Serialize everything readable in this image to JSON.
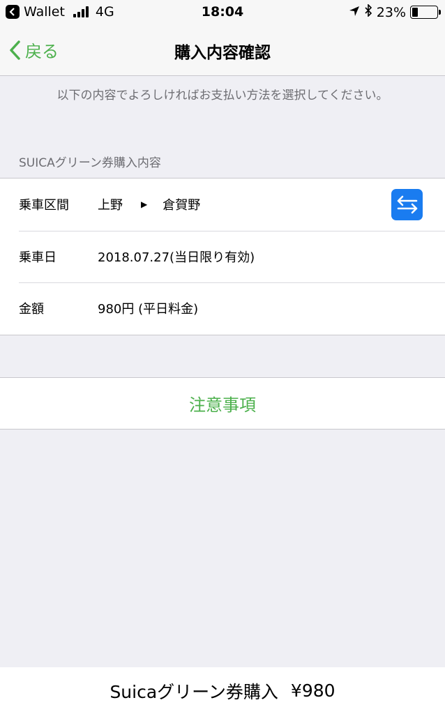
{
  "status_bar": {
    "back_app": "Wallet",
    "network": "4G",
    "time": "18:04",
    "battery_percent": "23%",
    "battery_level": 0.23
  },
  "nav": {
    "back_label": "戻る",
    "title": "購入内容確認"
  },
  "instruction": "以下の内容でよろしければお支払い方法を選択してください。",
  "section_header": "SUICAグリーン券購入内容",
  "details": {
    "route_label": "乗車区間",
    "route_from": "上野",
    "route_to": "倉賀野",
    "date_label": "乗車日",
    "date_value": "2018.07.27(当日限り有効)",
    "fare_label": "金額",
    "fare_value": "980円 (平日料金)"
  },
  "notice_label": "注意事項",
  "purchase": {
    "label": "Suicaグリーン券購入",
    "price": "¥980"
  },
  "colors": {
    "accent_green": "#4cb04c",
    "swap_blue": "#1a7cf0",
    "background": "#efeff4"
  },
  "icons": {
    "swap": "swap-arrows-icon",
    "back": "chevron-left-icon"
  }
}
